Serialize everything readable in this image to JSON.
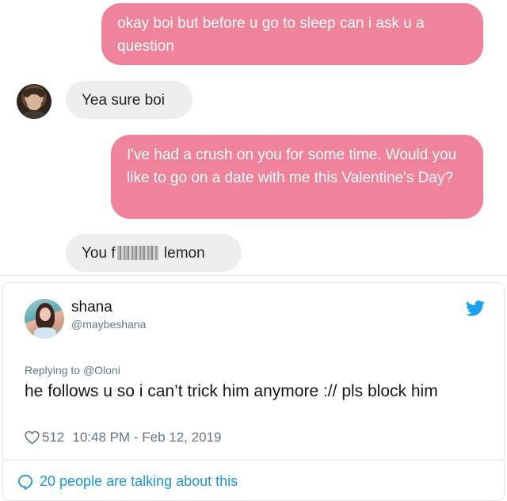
{
  "messages": [
    {
      "id": "b1",
      "side": "out",
      "text": "okay boi but before u go to sleep can i ask u a question"
    },
    {
      "id": "b2",
      "side": "in",
      "text": "Yea sure boi"
    },
    {
      "id": "b3",
      "side": "out",
      "text": "I've had a crush on you for some time. Would you like to go on a date with me this Valentine's Day?"
    },
    {
      "id": "b4",
      "side": "in",
      "text_before": "You f",
      "text_after": "lemon"
    }
  ],
  "tweet": {
    "name": "shana",
    "handle": "@maybeshana",
    "replying_to_prefix": "Replying to ",
    "replying_to_handle": "@Oloni",
    "text": "he follows u so i can’t trick him anymore :// pls block him",
    "likes": "512",
    "timestamp": "10:48 PM - Feb 12, 2019",
    "talking": "20 people are talking about this"
  },
  "colors": {
    "outgoing_bubble": "#f0839c",
    "incoming_bubble": "#eeeeee",
    "twitter_blue": "#1b95e0",
    "muted": "#657786"
  },
  "icons": [
    "twitter-bird-icon",
    "heart-icon",
    "speech-bubble-icon",
    "censor-blur"
  ]
}
